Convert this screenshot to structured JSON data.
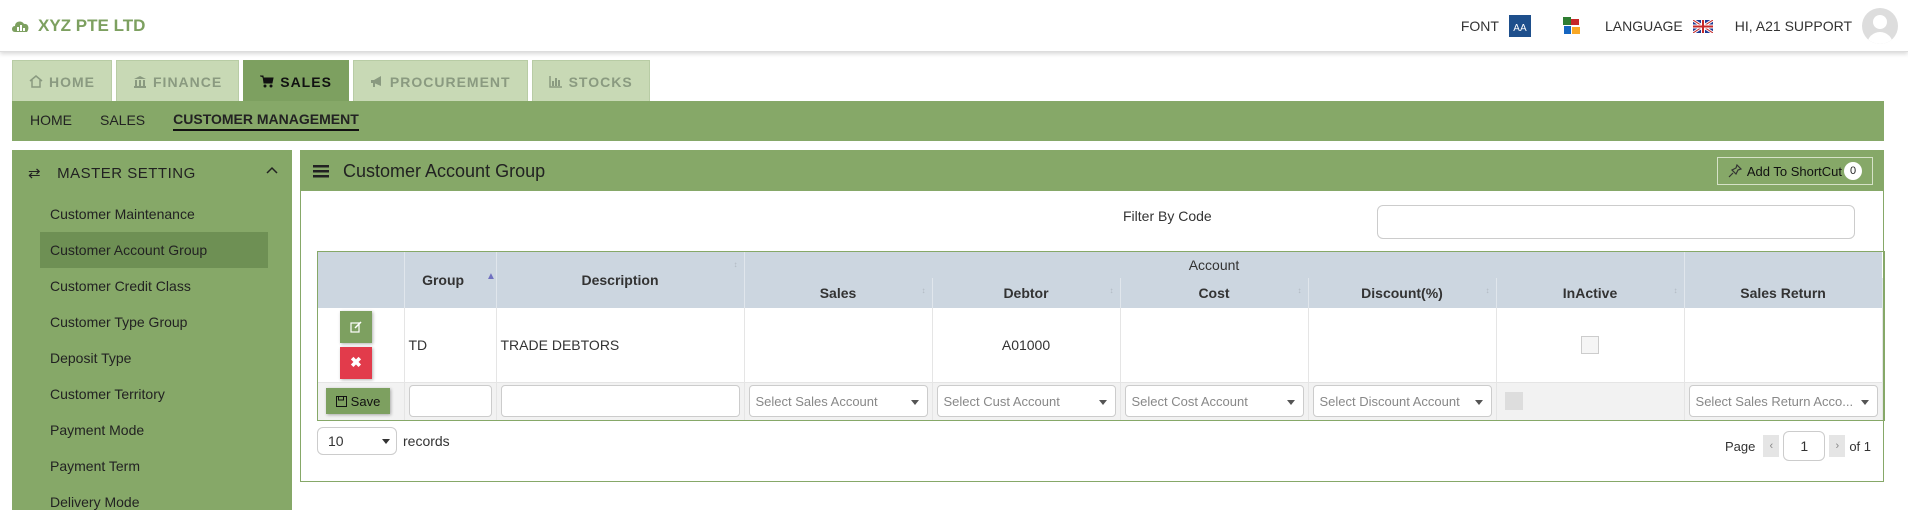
{
  "brand": {
    "name": "XYZ PTE LTD",
    "icon": "cloud-chart-icon"
  },
  "topbar": {
    "font_label": "FONT",
    "font_icon_text": "AA",
    "language_label": "LANGUAGE",
    "user_greeting": "HI, A21 SUPPORT"
  },
  "tabs": [
    {
      "label": "HOME",
      "icon": "home-icon"
    },
    {
      "label": "FINANCE",
      "icon": "bank-icon"
    },
    {
      "label": "SALES",
      "icon": "cart-icon"
    },
    {
      "label": "PROCUREMENT",
      "icon": "megaphone-icon"
    },
    {
      "label": "STOCKS",
      "icon": "bar-chart-icon"
    }
  ],
  "subnav": [
    "HOME",
    "SALES",
    "CUSTOMER MANAGEMENT"
  ],
  "sidebar": {
    "title": "MASTER SETTING",
    "items": [
      "Customer Maintenance",
      "Customer Account Group",
      "Customer Credit Class",
      "Customer Type Group",
      "Deposit Type",
      "Customer Territory",
      "Payment Mode",
      "Payment Term",
      "Delivery Mode"
    ]
  },
  "panel": {
    "title": "Customer Account Group",
    "shortcut_label": "Add To ShortCut",
    "shortcut_count": "0",
    "filter_label": "Filter By Code",
    "filter_value": ""
  },
  "table": {
    "group_header": "Account",
    "headers": {
      "group": "Group",
      "description": "Description",
      "sales": "Sales",
      "debtor": "Debtor",
      "cost": "Cost",
      "discount": "Discount(%)",
      "inactive": "InActive",
      "sales_return": "Sales Return"
    },
    "rows": [
      {
        "group": "TD",
        "description": "TRADE DEBTORS",
        "sales": "",
        "debtor": "A01000",
        "cost": "",
        "discount": "",
        "inactive": false,
        "sales_return": ""
      }
    ],
    "new_row": {
      "save_label": "Save",
      "sales_placeholder": "Select Sales Account",
      "debtor_placeholder": "Select Cust Account",
      "cost_placeholder": "Select Cost Account",
      "discount_placeholder": "Select Discount Account",
      "sales_return_placeholder": "Select Sales Return Acco..."
    }
  },
  "pager": {
    "page_size": "10",
    "records_label": "records",
    "page_label": "Page",
    "current_page": "1",
    "of_label": "of 1"
  }
}
